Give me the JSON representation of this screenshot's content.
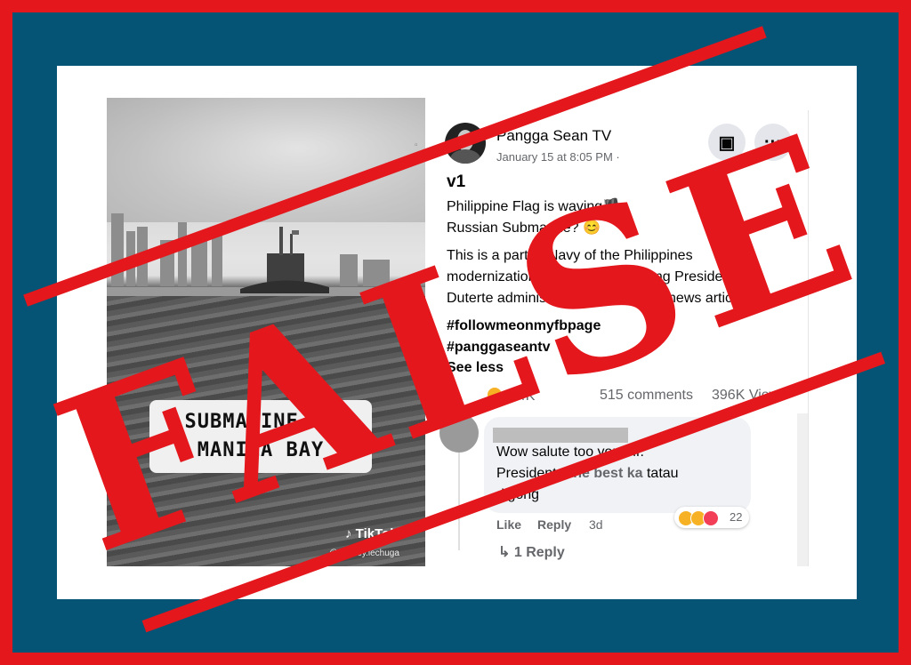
{
  "video": {
    "caption_line1": "SUBMARINE IN",
    "caption_line2": "MANILA BAY",
    "tiktok_logo": "TikTok",
    "tiktok_handle": "@stanley.lechuga"
  },
  "post": {
    "author": "Pangga Sean TV",
    "date": "January 15 at 8:05 PM ·",
    "title": "v1",
    "lines": [
      "Philippine Flag is waving🏴",
      "Russian Submarine? 😊"
    ],
    "body_lines": [
      "This is a part of Navy of the Philippines",
      "modernization 2 submarine binili ng President",
      "Duterte administration base on the news article"
    ],
    "hashtags": [
      "#followmeonmyfbpage",
      "#panggaseantv"
    ],
    "see_less": "See less",
    "reactions_count": "5.4K",
    "comments_count": "515 comments",
    "views_count": "396K Views"
  },
  "comment": {
    "text_line1": "Wow salute too you Mr.",
    "text_line2_prefix": "President . ",
    "text_line2_bold": "the best ka",
    "text_line2_suffix": " tatau",
    "text_line3": "digong",
    "like_label": "Like",
    "reply_label": "Reply",
    "time": "3d",
    "reaction_count": "22",
    "replies_label": "1 Reply"
  },
  "stamp": {
    "text": "FALSE",
    "color": "#e4171c"
  },
  "colors": {
    "outer_frame": "#e4171c",
    "inner_frame": "#065475"
  }
}
